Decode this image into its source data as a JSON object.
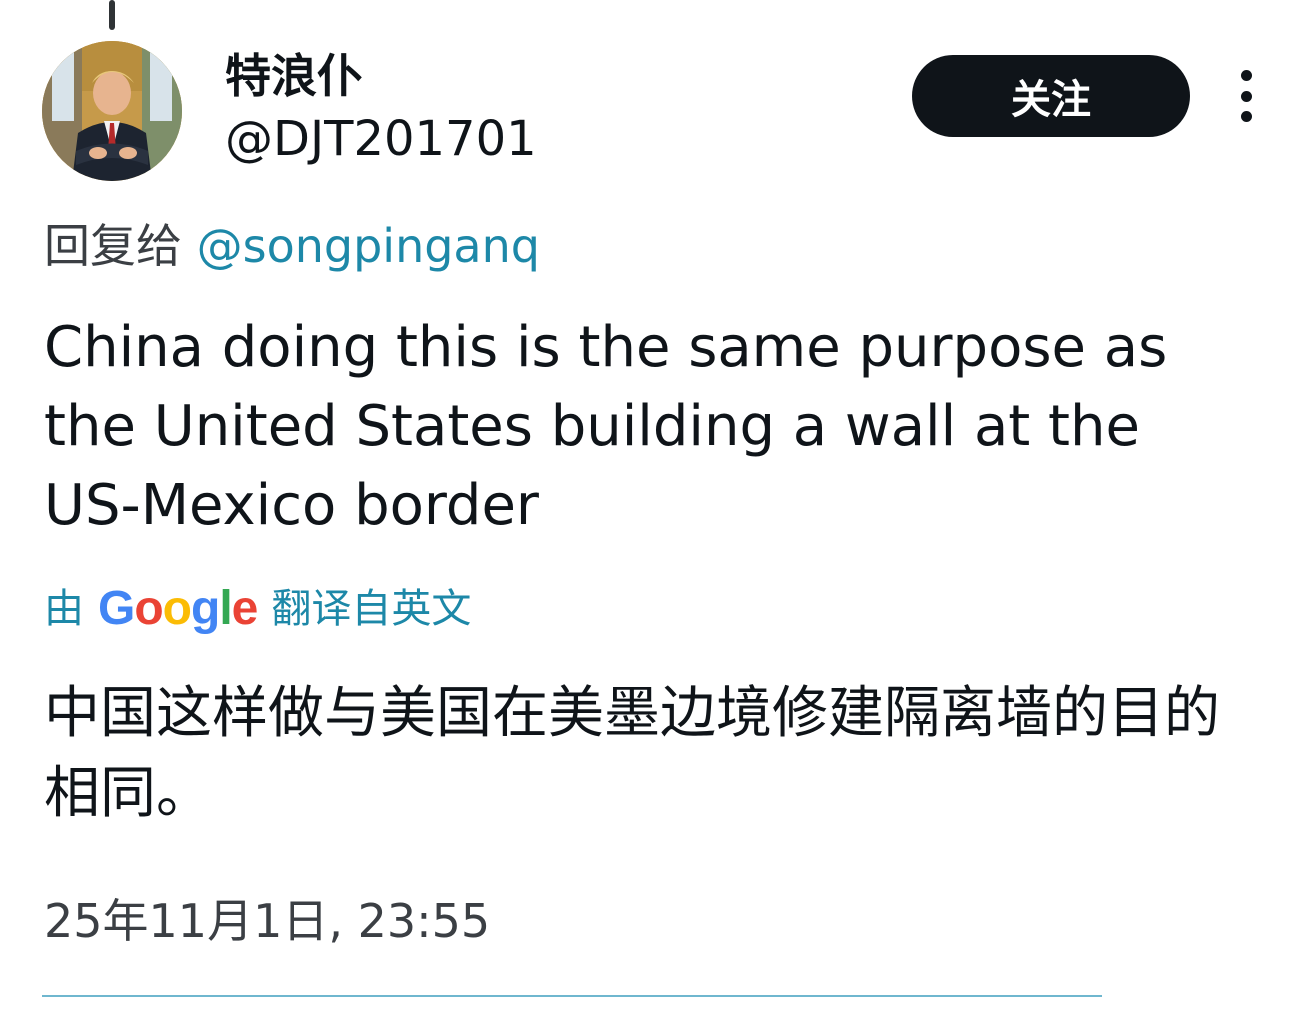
{
  "author": {
    "display_name": "特浪仆",
    "handle": "@DJT201701"
  },
  "actions": {
    "follow_label": "关注"
  },
  "reply": {
    "prefix": "回复给",
    "mention": "@songpinganq"
  },
  "tweet": {
    "text": "China doing this is the same purpose as the United States building a wall at the US-Mexico border"
  },
  "translation": {
    "by": "由",
    "provider_letters": [
      "G",
      "o",
      "o",
      "g",
      "l",
      "e"
    ],
    "suffix": "翻译自英文",
    "text": "中国这样做与美国在美墨边境修建隔离墙的目的相同。"
  },
  "timestamp": "25年11月1日, 23:55",
  "colors": {
    "primary_text": "#0f1419",
    "link": "#1d88a8",
    "follow_bg": "#0f1419",
    "google_blue": "#4285f4",
    "google_red": "#ea4335",
    "google_yellow": "#fbbc05",
    "google_green": "#34a853"
  },
  "icons": {
    "more": "more-vertical-icon",
    "avatar": "profile-photo"
  }
}
